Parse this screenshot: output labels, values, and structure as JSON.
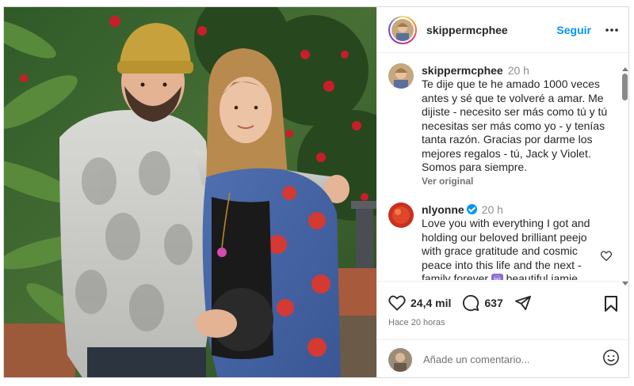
{
  "post": {
    "author": "skippermcphee",
    "follow_label": "Seguir"
  },
  "comments": [
    {
      "username": "skippermcphee",
      "time": "20 h",
      "lines": [
        "Te dije que te he amado 1000 veces",
        "antes y sé que te volveré a amar. Me",
        "dijiste - necesito ser más como tú y tú",
        "necesitas ser más como yo - y tenías",
        "tanta razón. Gracias por darme los",
        "mejores regalos - tú, Jack y Violet.",
        "Somos para siempre."
      ],
      "link": "Ver original"
    },
    {
      "username": "nlyonne",
      "verified": true,
      "time": "20 h",
      "lines": [
        "Love you with everything I got and",
        "holding our beloved brilliant peejo",
        "with grace gratitude and cosmic",
        "peace into this life and the next -"
      ],
      "last_line_before": "family forever",
      "emoji": "♾",
      "last_line_after": "beautiful jamie"
    }
  ],
  "actions": {
    "likes": "24,4 mil",
    "comments": "637",
    "timestamp": "Hace 20 horas"
  },
  "add_comment": {
    "placeholder": "Añade un comentario..."
  },
  "icons": {
    "more": "more-horizontal-icon",
    "heart": "heart-icon",
    "comment": "comment-icon",
    "share": "share-icon",
    "save": "bookmark-icon",
    "emoji": "emoji-icon"
  },
  "colors": {
    "link_blue": "#0095f6",
    "text": "#262626",
    "muted": "#737373"
  }
}
